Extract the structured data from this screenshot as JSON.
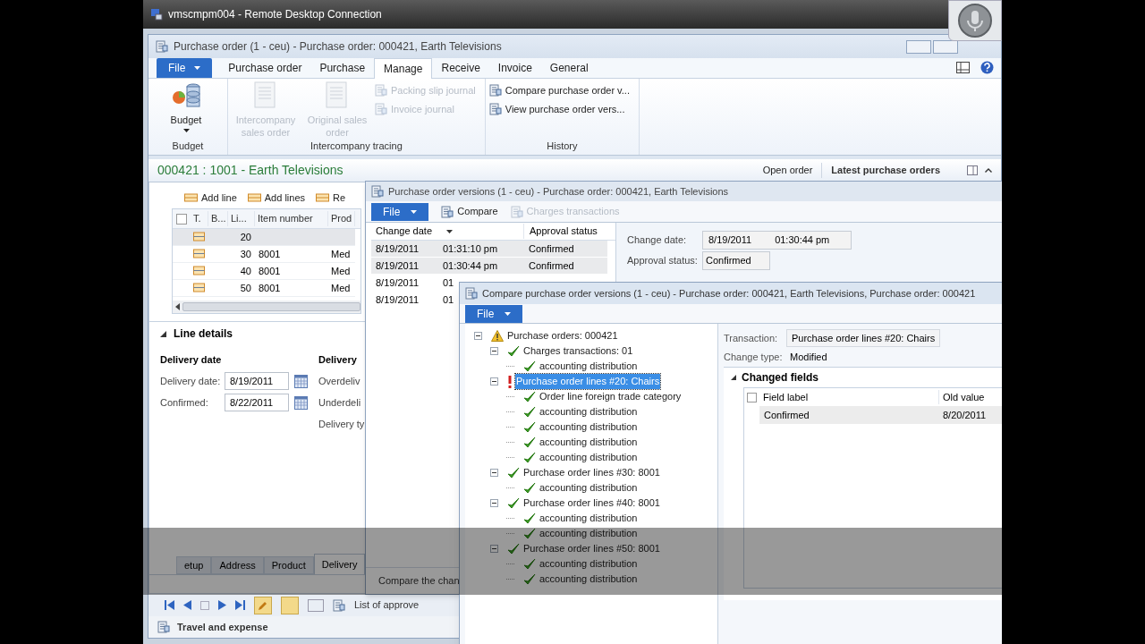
{
  "remote_desktop": {
    "title": "vmscmpm004 - Remote Desktop Connection"
  },
  "main_window": {
    "title": "Purchase order (1 - ceu) - Purchase order: 000421, Earth Televisions",
    "tabs": [
      {
        "label": "File",
        "kind": "file",
        "selected": false
      },
      {
        "label": "Purchase order",
        "kind": "tab",
        "selected": false
      },
      {
        "label": "Purchase",
        "kind": "tab",
        "selected": false
      },
      {
        "label": "Manage",
        "kind": "tab",
        "selected": true
      },
      {
        "label": "Receive",
        "kind": "tab",
        "selected": false
      },
      {
        "label": "Invoice",
        "kind": "tab",
        "selected": false
      },
      {
        "label": "General",
        "kind": "tab",
        "selected": false
      }
    ],
    "ribbon_groups": [
      {
        "label": "Budget",
        "buttons": [
          {
            "label": "Budget",
            "kind": "dropdown",
            "disabled": false
          }
        ]
      },
      {
        "label": "Intercompany tracing",
        "buttons": [
          {
            "label": "Intercompany sales order",
            "kind": "large",
            "disabled": true
          },
          {
            "label": "Original sales order",
            "kind": "large",
            "disabled": true
          },
          {
            "label": "Packing slip journal",
            "kind": "small",
            "disabled": true
          },
          {
            "label": "Invoice journal",
            "kind": "small",
            "disabled": true
          }
        ]
      },
      {
        "label": "History",
        "buttons": [
          {
            "label": "Compare purchase order v...",
            "kind": "small",
            "disabled": false
          },
          {
            "label": "View purchase order vers...",
            "kind": "small",
            "disabled": false
          }
        ]
      }
    ],
    "heading": "000421 : 1001 - Earth Televisions",
    "header_links": [
      "Open order",
      "Latest purchase orders"
    ],
    "line_actions": [
      "Add line",
      "Add lines",
      "Re"
    ],
    "grid": {
      "select_all_checked": false,
      "columns": [
        "T.",
        "B...",
        "Li...",
        "Item number",
        "Prod"
      ],
      "rows": [
        {
          "line": "20",
          "selected": true
        },
        {
          "line": "30",
          "item": "8001",
          "product": "Med",
          "selected": false
        },
        {
          "line": "40",
          "item": "8001",
          "product": "Med",
          "selected": false
        },
        {
          "line": "50",
          "item": "8001",
          "product": "Med",
          "selected": false
        }
      ]
    },
    "line_details": {
      "title": "Line details",
      "groups": [
        {
          "title": "Delivery date",
          "fields": [
            {
              "label": "Delivery date:",
              "value": "8/19/2011"
            },
            {
              "label": "Confirmed:",
              "value": "8/22/2011"
            }
          ]
        },
        {
          "title": "Delivery",
          "fields": [
            {
              "label": "Overdeliv"
            },
            {
              "label": "Underdeli"
            },
            {
              "label": "Delivery ty"
            }
          ]
        }
      ]
    },
    "bottom_tabs": [
      {
        "label": "etup",
        "selected": false
      },
      {
        "label": "Address",
        "selected": false
      },
      {
        "label": "Product",
        "selected": false
      },
      {
        "label": "Delivery",
        "selected": true
      }
    ],
    "nav_text": "List of approve",
    "footer": "Travel and expense"
  },
  "versions_window": {
    "title": "Purchase order versions (1 - ceu) - Purchase order: 000421, Earth Televisions",
    "file": "File",
    "toolbar": [
      {
        "label": "Compare",
        "disabled": false
      },
      {
        "label": "Charges transactions",
        "disabled": true
      }
    ],
    "columns": [
      "Change date",
      "Approval status"
    ],
    "rows": [
      {
        "date": "8/19/2011",
        "time": "01:31:10 pm",
        "status": "Confirmed",
        "selected": true
      },
      {
        "date": "8/19/2011",
        "time": "01:30:44 pm",
        "status": "Confirmed",
        "selected": true
      },
      {
        "date": "8/19/2011",
        "time": "01",
        "selected": false
      },
      {
        "date": "8/19/2011",
        "time": "01",
        "selected": false
      }
    ],
    "change_date": {
      "label": "Change date:",
      "date": "8/19/2011",
      "time": "01:30:44 pm"
    },
    "approval_status": {
      "label": "Approval status:",
      "value": "Confirmed"
    },
    "footer": "Compare the chan"
  },
  "compare_window": {
    "title": "Compare purchase order versions (1 - ceu) - Purchase order: 000421, Earth Televisions, Purchase order: 000421",
    "file": "File",
    "tree": [
      {
        "label": "Purchase orders: 000421",
        "kind": "warning",
        "selected": false,
        "expanded": true,
        "children": [
          {
            "label": "Charges transactions: 01",
            "kind": "ok",
            "selected": false,
            "expanded": true,
            "children": [
              {
                "label": "accounting distribution",
                "kind": "ok",
                "selected": false
              }
            ]
          },
          {
            "label": "Purchase order lines #20: Chairs",
            "kind": "error",
            "selected": true,
            "expanded": true,
            "children": [
              {
                "label": "Order line foreign trade category",
                "kind": "ok",
                "selected": false
              },
              {
                "label": "accounting distribution",
                "kind": "ok",
                "selected": false
              },
              {
                "label": "accounting distribution",
                "kind": "ok",
                "selected": false
              },
              {
                "label": "accounting distribution",
                "kind": "ok",
                "selected": false
              },
              {
                "label": "accounting distribution",
                "kind": "ok",
                "selected": false
              }
            ]
          },
          {
            "label": "Purchase order lines #30: 8001",
            "kind": "ok",
            "selected": false,
            "expanded": true,
            "children": [
              {
                "label": "accounting distribution",
                "kind": "ok",
                "selected": false
              }
            ]
          },
          {
            "label": "Purchase order lines #40: 8001",
            "kind": "ok",
            "selected": false,
            "expanded": true,
            "children": [
              {
                "label": "accounting distribution",
                "kind": "ok",
                "selected": false
              },
              {
                "label": "accounting distribution",
                "kind": "ok",
                "selected": false
              }
            ]
          },
          {
            "label": "Purchase order lines #50: 8001",
            "kind": "ok",
            "selected": false,
            "expanded": true,
            "children": [
              {
                "label": "accounting distribution",
                "kind": "ok",
                "selected": false
              },
              {
                "label": "accounting distribution",
                "kind": "ok",
                "selected": false
              }
            ]
          }
        ]
      }
    ],
    "transaction": {
      "label": "Transaction:",
      "value": "Purchase order lines #20: Chairs"
    },
    "change_type": {
      "label": "Change type:",
      "value": "Modified"
    },
    "changed_fields": {
      "title": "Changed fields",
      "select_all_checked": false,
      "columns": [
        "Field label",
        "Old value"
      ],
      "rows": [
        {
          "field": "Confirmed",
          "old_value": "8/20/2011",
          "selected": true
        }
      ]
    }
  }
}
